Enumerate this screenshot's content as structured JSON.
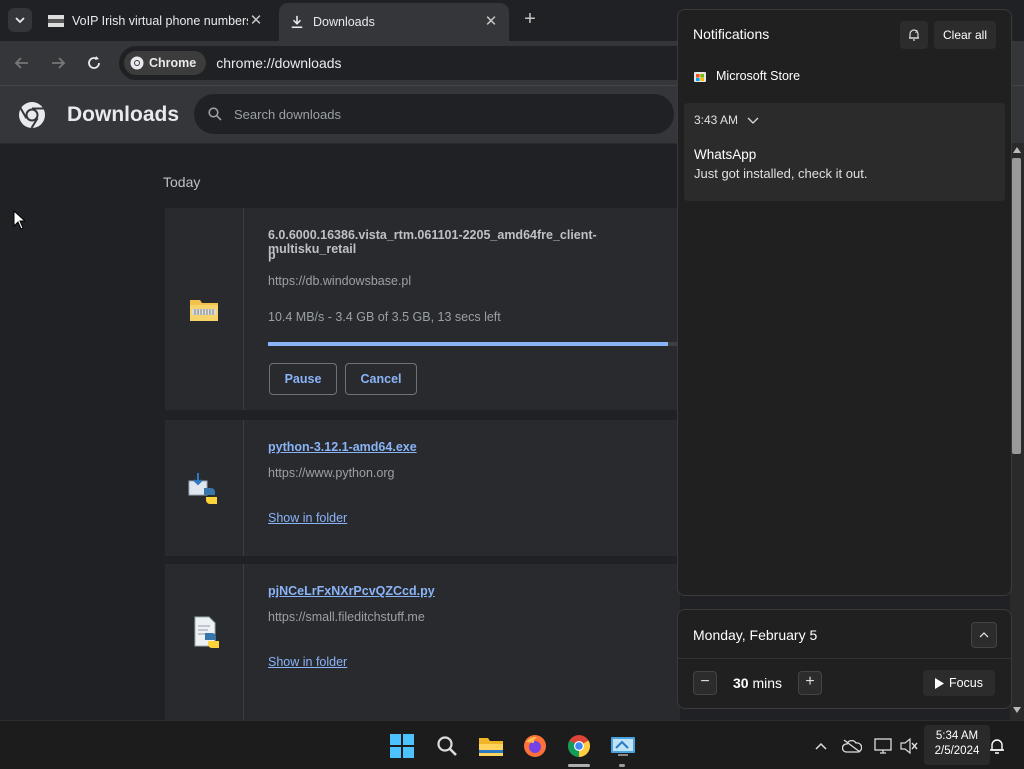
{
  "browser": {
    "tabs": [
      {
        "title": "VoIP Irish virtual phone numbers",
        "active": false
      },
      {
        "title": "Downloads",
        "active": true
      }
    ],
    "omnibox": {
      "chip_label": "Chrome",
      "url": "chrome://downloads"
    }
  },
  "downloads_page": {
    "title": "Downloads",
    "search_placeholder": "Search downloads",
    "section_label": "Today",
    "items": [
      {
        "filename_line1": "6.0.6000.16386.vista_rtm.061101-2205_amd64fre_client-multisku_retail",
        "filename_line2": "p",
        "source": "https://db.windowsbase.pl",
        "status": "10.4 MB/s - 3.4 GB of 3.5 GB, 13 secs left",
        "progress": 0.97,
        "pause_label": "Pause",
        "cancel_label": "Cancel",
        "icon": "zip-folder-icon"
      },
      {
        "filename": "python-3.12.1-amd64.exe",
        "source": "https://www.python.org",
        "action_label": "Show in folder",
        "icon": "python-installer-icon"
      },
      {
        "filename": "pjNCeLrFxNXrPcvQZCcd.py",
        "source": "https://small.fileditchstuff.me",
        "action_label": "Show in folder",
        "icon": "python-file-icon"
      }
    ]
  },
  "notifications": {
    "title": "Notifications",
    "clear_all_label": "Clear all",
    "app_name": "Microsoft Store",
    "time": "3:43 AM",
    "notif_app": "WhatsApp",
    "notif_body": "Just got installed, check it out."
  },
  "calendar": {
    "date": "Monday, February 5",
    "focus_value": "30",
    "focus_unit": "mins",
    "focus_label": "Focus"
  },
  "taskbar": {
    "time": "5:34 AM",
    "date": "2/5/2024"
  },
  "colors": {
    "accent": "#8ab4f8",
    "page_bg": "#202124",
    "card_bg": "#292a2d",
    "toolbar_bg": "#35363a"
  }
}
